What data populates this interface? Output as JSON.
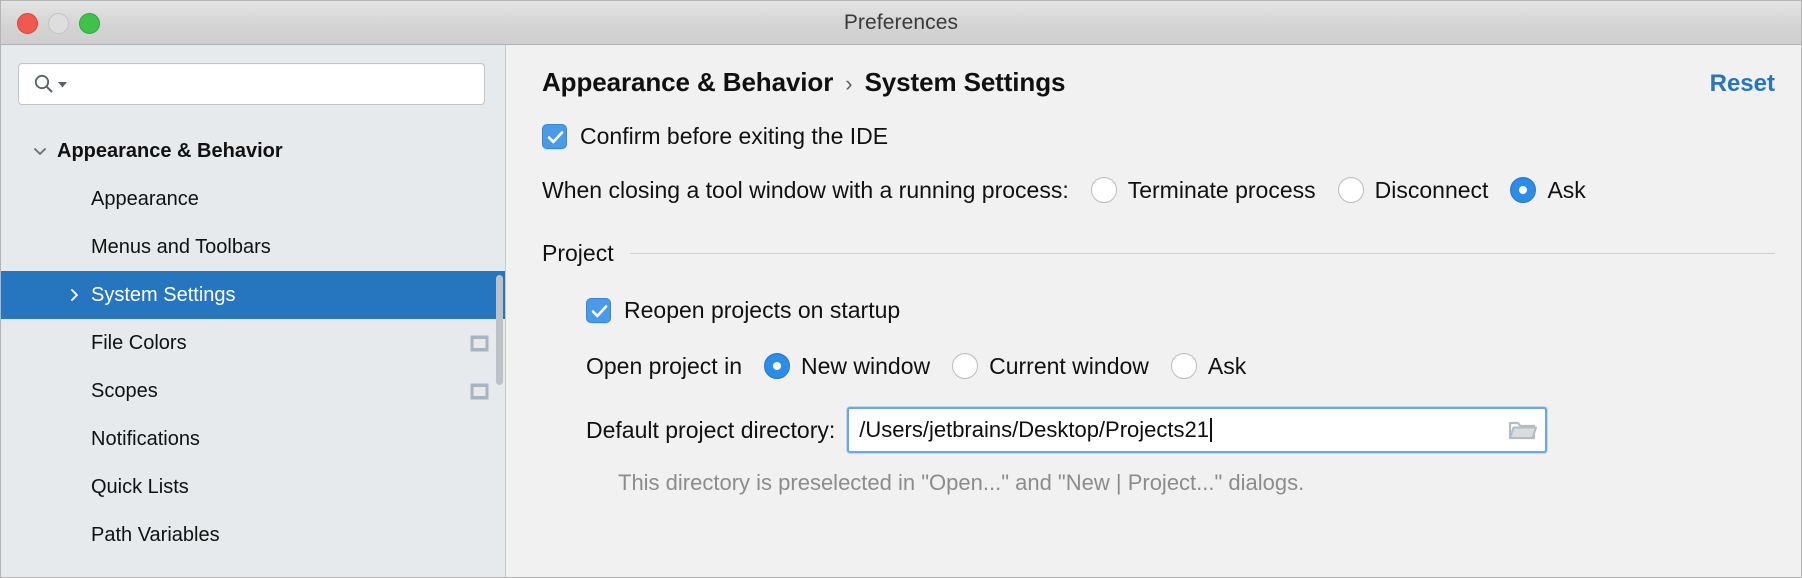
{
  "window": {
    "title": "Preferences",
    "controls": [
      {
        "name": "close",
        "color": "#f0594f"
      },
      {
        "name": "minimize",
        "color": "#dedede"
      },
      {
        "name": "maximize",
        "color": "#3fc14b"
      }
    ]
  },
  "sidebar": {
    "search": {
      "value": "",
      "placeholder": ""
    },
    "tree": [
      {
        "label": "Appearance & Behavior",
        "level": 0,
        "bold": true,
        "twisty": "chevron-down",
        "selected": false,
        "badge": null
      },
      {
        "label": "Appearance",
        "level": 1,
        "bold": false,
        "twisty": null,
        "selected": false,
        "badge": null
      },
      {
        "label": "Menus and Toolbars",
        "level": 1,
        "bold": false,
        "twisty": null,
        "selected": false,
        "badge": null
      },
      {
        "label": "System Settings",
        "level": 1,
        "bold": false,
        "twisty": "chevron-right",
        "selected": true,
        "badge": null
      },
      {
        "label": "File Colors",
        "level": 1,
        "bold": false,
        "twisty": null,
        "selected": false,
        "badge": "project-scope-icon"
      },
      {
        "label": "Scopes",
        "level": 1,
        "bold": false,
        "twisty": null,
        "selected": false,
        "badge": "project-scope-icon"
      },
      {
        "label": "Notifications",
        "level": 1,
        "bold": false,
        "twisty": null,
        "selected": false,
        "badge": null
      },
      {
        "label": "Quick Lists",
        "level": 1,
        "bold": false,
        "twisty": null,
        "selected": false,
        "badge": null
      },
      {
        "label": "Path Variables",
        "level": 1,
        "bold": false,
        "twisty": null,
        "selected": false,
        "badge": null
      }
    ]
  },
  "main": {
    "breadcrumb": {
      "parent": "Appearance & Behavior",
      "separator": "›",
      "current": "System Settings"
    },
    "reset_label": "Reset",
    "confirm_exit": {
      "label": "Confirm before exiting the IDE",
      "checked": true
    },
    "closing_tool_window": {
      "label": "When closing a tool window with a running process:",
      "options": [
        {
          "label": "Terminate process",
          "selected": false
        },
        {
          "label": "Disconnect",
          "selected": false
        },
        {
          "label": "Ask",
          "selected": true
        }
      ]
    },
    "project_section": {
      "title": "Project",
      "reopen": {
        "label": "Reopen projects on startup",
        "checked": true
      },
      "open_project_in": {
        "label": "Open project in",
        "options": [
          {
            "label": "New window",
            "selected": true
          },
          {
            "label": "Current window",
            "selected": false
          },
          {
            "label": "Ask",
            "selected": false
          }
        ]
      },
      "default_directory": {
        "label": "Default project directory:",
        "value": "/Users/jetbrains/Desktop/Projects21",
        "placeholder": "",
        "browse_icon": "folder-icon",
        "hint": "This directory is preselected in \"Open...\" and \"New | Project...\" dialogs."
      }
    }
  },
  "colors": {
    "accent": "#2675bf",
    "checkbox": "#4a9ae8",
    "radio_on": "#2d8ce6",
    "sidebar_bg": "#e6eaed",
    "main_bg": "#f1f1f1"
  }
}
